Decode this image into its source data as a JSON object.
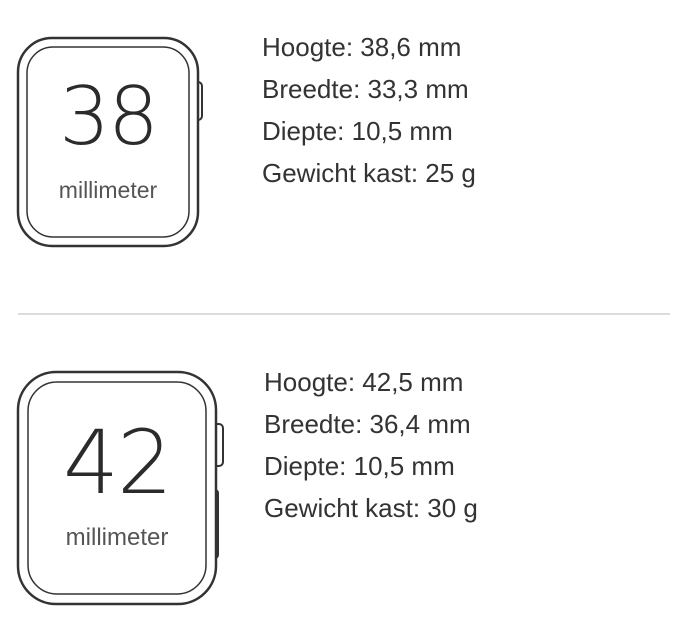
{
  "watches": [
    {
      "size": "38",
      "unit": "millimeter",
      "specs": [
        "Hoogte: 38,6 mm",
        "Breedte: 33,3 mm",
        "Diepte: 10,5 mm",
        "Gewicht kast: 25 g"
      ]
    },
    {
      "size": "42",
      "unit": "millimeter",
      "specs": [
        "Hoogte: 42,5 mm",
        "Breedte: 36,4 mm",
        "Diepte: 10,5 mm",
        "Gewicht kast: 30 g"
      ]
    }
  ]
}
